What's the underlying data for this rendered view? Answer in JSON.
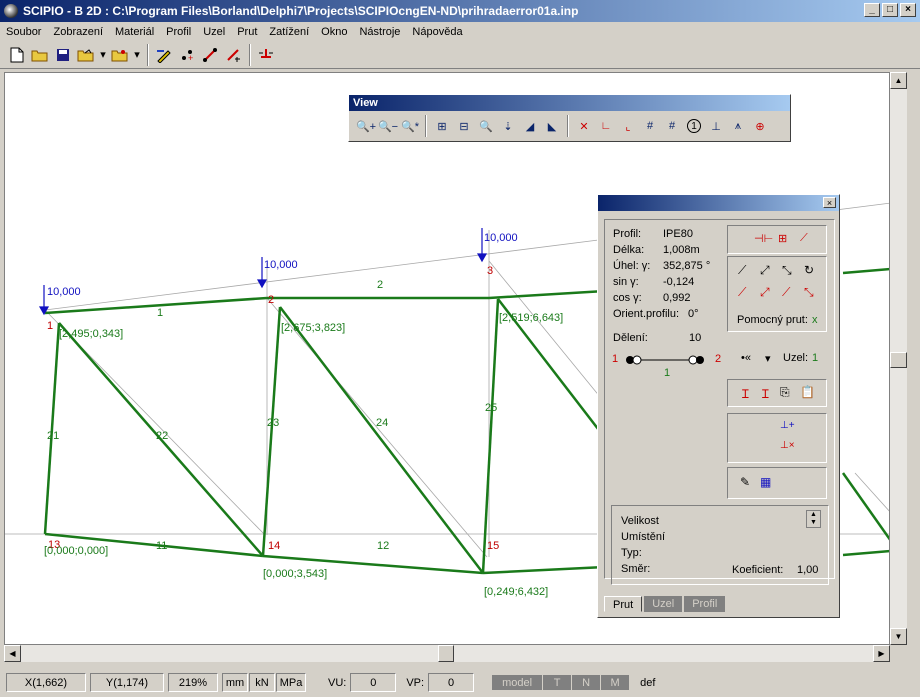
{
  "window": {
    "title": "SCIPIO - B 2D : C:\\Program Files\\Borland\\Delphi7\\Projects\\SCIPIOcngEN-ND\\prihradaerror01a.inp"
  },
  "menu": [
    "Soubor",
    "Zobrazení",
    "Materiál",
    "Profil",
    "Uzel",
    "Prut",
    "Zatížení",
    "Okno",
    "Nástroje",
    "Nápověda"
  ],
  "view_toolbar": {
    "title": "View",
    "circled_label": "1"
  },
  "drawing": {
    "nodes": [
      {
        "id": "1",
        "coord": "[2,495;0,343]"
      },
      {
        "id": "2",
        "coord": "[2,675;3,823]"
      },
      {
        "id": "3",
        "coord": "[2,519;6,643]"
      },
      {
        "id": "13",
        "coord": "[0,000;0,000]"
      },
      {
        "id": "14",
        "coord": "[0,000;3,543]"
      },
      {
        "id": "15",
        "coord": "[0,249;6,432]"
      }
    ],
    "members": [
      "1",
      "2",
      "11",
      "12",
      "21",
      "22",
      "23",
      "24",
      "25"
    ],
    "loads": [
      "10,000",
      "10,000",
      "10,000"
    ]
  },
  "panel": {
    "profil_label": "Profil:",
    "profil_value": "IPE80",
    "delka_label": "Délka:",
    "delka_value": "1,008m",
    "uhel_label": "Úhel:  γ:",
    "uhel_value": "352,875 °",
    "sin_label": "sin γ:",
    "sin_value": "-0,124",
    "cos_label": "cos γ:",
    "cos_value": "0,992",
    "orient_label": "Orient.profilu:",
    "orient_value": "0°",
    "deleni_label": "Dělení:",
    "deleni_value": "10",
    "node_start": "1",
    "node_end": "2",
    "member_no": "1",
    "pomocny_label": "Pomocný prut:",
    "pomocny_value": "x",
    "uzel_label": "Uzel:",
    "uzel_value": "1",
    "velikost_label": "Velikost",
    "umisteni_label": "Umístění",
    "typ_label": "Typ:",
    "smer_label": "Směr:",
    "koeficient_label": "Koeficient:",
    "koeficient_value": "1,00",
    "tabs": [
      "Prut",
      "Uzel",
      "Profil"
    ]
  },
  "status": {
    "x": "X(1,662)",
    "y": "Y(1,174)",
    "zoom": "219%",
    "units": [
      "mm",
      "kN",
      "MPa"
    ],
    "vu_label": "VU:",
    "vu_value": "0",
    "vp_label": "VP:",
    "vp_value": "0",
    "mode_tabs": [
      "model",
      "T",
      "N",
      "M"
    ],
    "def_label": "def"
  },
  "colors": {
    "member": "#1a7a1a",
    "node_label": "#c00000",
    "load": "#1010c0",
    "titlebar": "#0a246a"
  }
}
